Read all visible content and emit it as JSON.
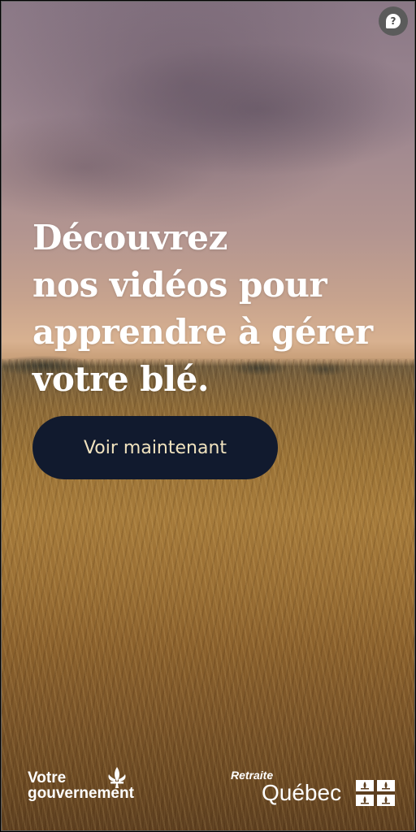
{
  "ad": {
    "headline_lines": [
      "Découvrez",
      "nos vidéos pour",
      "apprendre à gérer",
      "votre blé."
    ],
    "cta_label": "Voir maintenant",
    "help_icon_glyph": "?",
    "help_icon": "help-question-icon",
    "background_image": "wheat field at sunset under a pinkish cloudy sky"
  },
  "footer": {
    "gov_logo": {
      "line1": "Votre",
      "line2": "gouvernement",
      "icon": "fleur-de-lis-icon"
    },
    "qc_logo": {
      "retraite": "Retraite",
      "quebec": "Québec",
      "icon": "quebec-flag-icon"
    }
  },
  "colors": {
    "cta_background": "#111a2e",
    "cta_text": "#f1e3bf",
    "headline_text": "#ffffff",
    "help_button": "#5b5b5b"
  }
}
